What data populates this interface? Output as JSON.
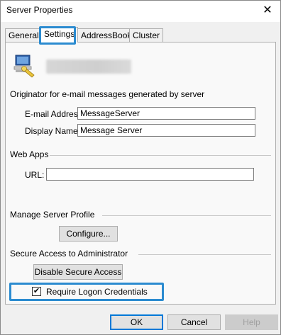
{
  "window": {
    "title": "Server Properties",
    "close_glyph": "✕"
  },
  "tabs": [
    {
      "label": "General"
    },
    {
      "label": "Settings"
    },
    {
      "label": "AddressBook"
    },
    {
      "label": "Cluster"
    }
  ],
  "originator": {
    "heading": "Originator for e-mail messages generated by server",
    "email_label": "E-mail Address:",
    "email_value": "MessageServer",
    "display_label": "Display Name:",
    "display_value": "Message Server"
  },
  "webapps": {
    "heading": "Web Apps",
    "url_label": "URL:",
    "url_value": ""
  },
  "profile": {
    "heading": "Manage Server Profile",
    "configure_label": "Configure..."
  },
  "secure": {
    "heading": "Secure Access to Administrator",
    "disable_label": "Disable Secure Access",
    "require_logon_label": "Require Logon Credentials",
    "require_logon_checked": true
  },
  "footer": {
    "ok_label": "OK",
    "cancel_label": "Cancel",
    "help_label": "Help"
  },
  "colors": {
    "highlight": "#2b8bd0",
    "default_button_border": "#0078d7"
  },
  "icons": {
    "server": "server-computer-icon",
    "close": "close-icon"
  }
}
